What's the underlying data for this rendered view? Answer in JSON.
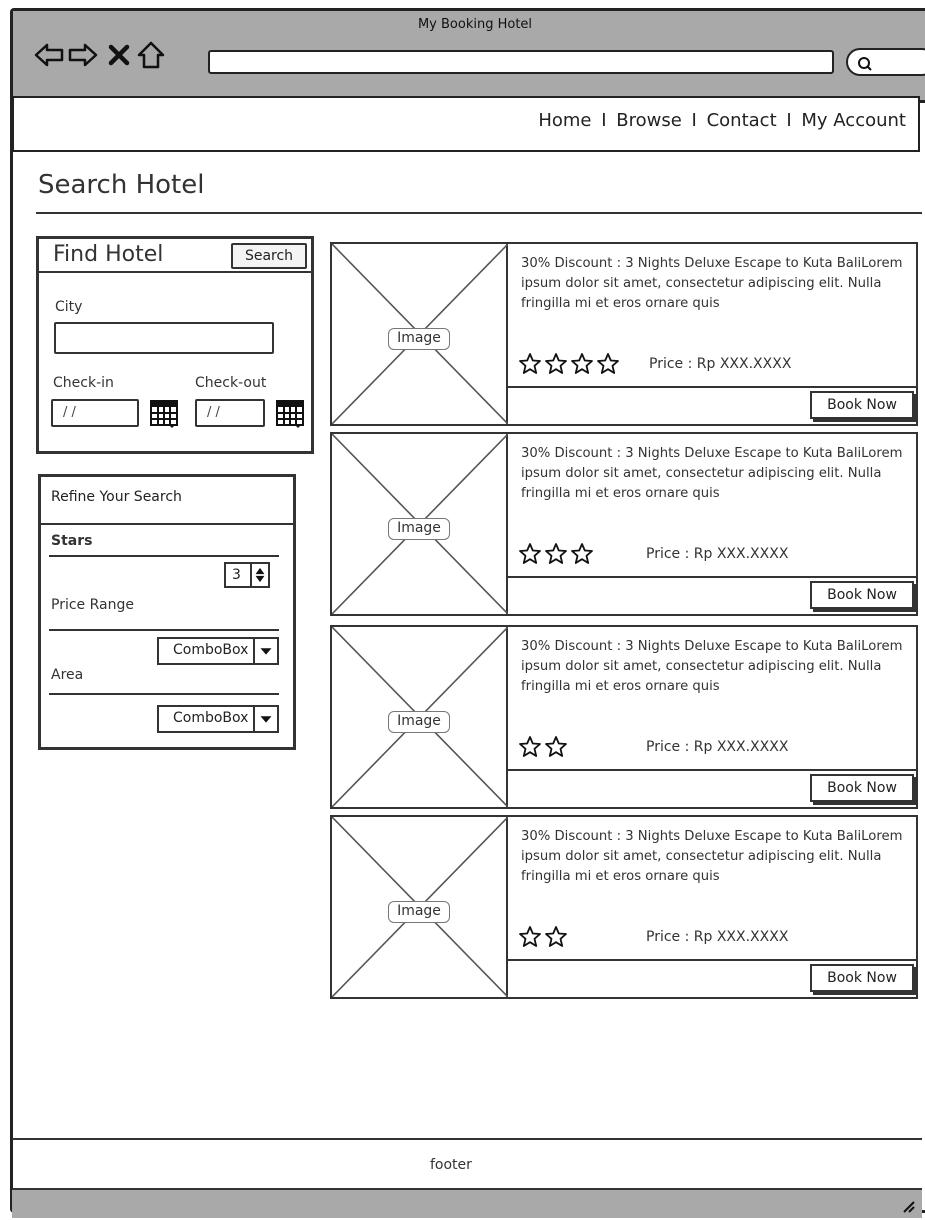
{
  "window": {
    "title": "My Booking Hotel"
  },
  "nav": {
    "links": [
      "Home",
      "Browse",
      "Contact",
      "My Account"
    ],
    "separator": "I"
  },
  "page": {
    "title": "Search Hotel"
  },
  "find_panel": {
    "title": "Find Hotel",
    "search_button": "Search",
    "city_label": "City",
    "city_value": "",
    "checkin_label": "Check-in",
    "checkout_label": "Check-out",
    "checkin_value": "/ /",
    "checkout_value": "/ /"
  },
  "refine": {
    "title": "Refine Your Search",
    "stars_label": "Stars",
    "stars_value": "3",
    "price_label": "Price Range",
    "price_value": "ComboBox",
    "area_label": "Area",
    "area_value": "ComboBox"
  },
  "results": [
    {
      "image_label": "Image",
      "description": "30% Discount : 3 Nights Deluxe Escape to Kuta BaliLorem ipsum dolor sit amet, consectetur adipiscing elit. Nulla fringilla mi et eros ornare quis",
      "stars": 4,
      "price": "Price : Rp XXX.XXXX",
      "book_label": "Book Now"
    },
    {
      "image_label": "Image",
      "description": "30% Discount : 3 Nights Deluxe Escape to Kuta BaliLorem ipsum dolor sit amet, consectetur adipiscing elit. Nulla fringilla mi et eros ornare quis",
      "stars": 3,
      "price": "Price : Rp XXX.XXXX",
      "book_label": "Book Now"
    },
    {
      "image_label": "Image",
      "description": "30% Discount : 3 Nights Deluxe Escape to Kuta BaliLorem ipsum dolor sit amet, consectetur adipiscing elit. Nulla fringilla mi et eros ornare quis",
      "stars": 2,
      "price": "Price : Rp XXX.XXXX",
      "book_label": "Book Now"
    },
    {
      "image_label": "Image",
      "description": "30% Discount : 3 Nights Deluxe Escape to Kuta BaliLorem ipsum dolor sit amet, consectetur adipiscing elit. Nulla fringilla mi et eros ornare quis",
      "stars": 2,
      "price": "Price : Rp XXX.XXXX",
      "book_label": "Book Now"
    }
  ],
  "footer": {
    "text": "footer"
  },
  "icons": {
    "back": "arrow-left-icon",
    "forward": "arrow-right-icon",
    "stop": "close-icon",
    "home": "home-icon",
    "search": "search-icon",
    "calendar": "calendar-icon",
    "star": "star-icon",
    "resize": "resize-grip-icon"
  },
  "colors": {
    "chrome": "#a9a9a9",
    "ink": "#222222"
  }
}
